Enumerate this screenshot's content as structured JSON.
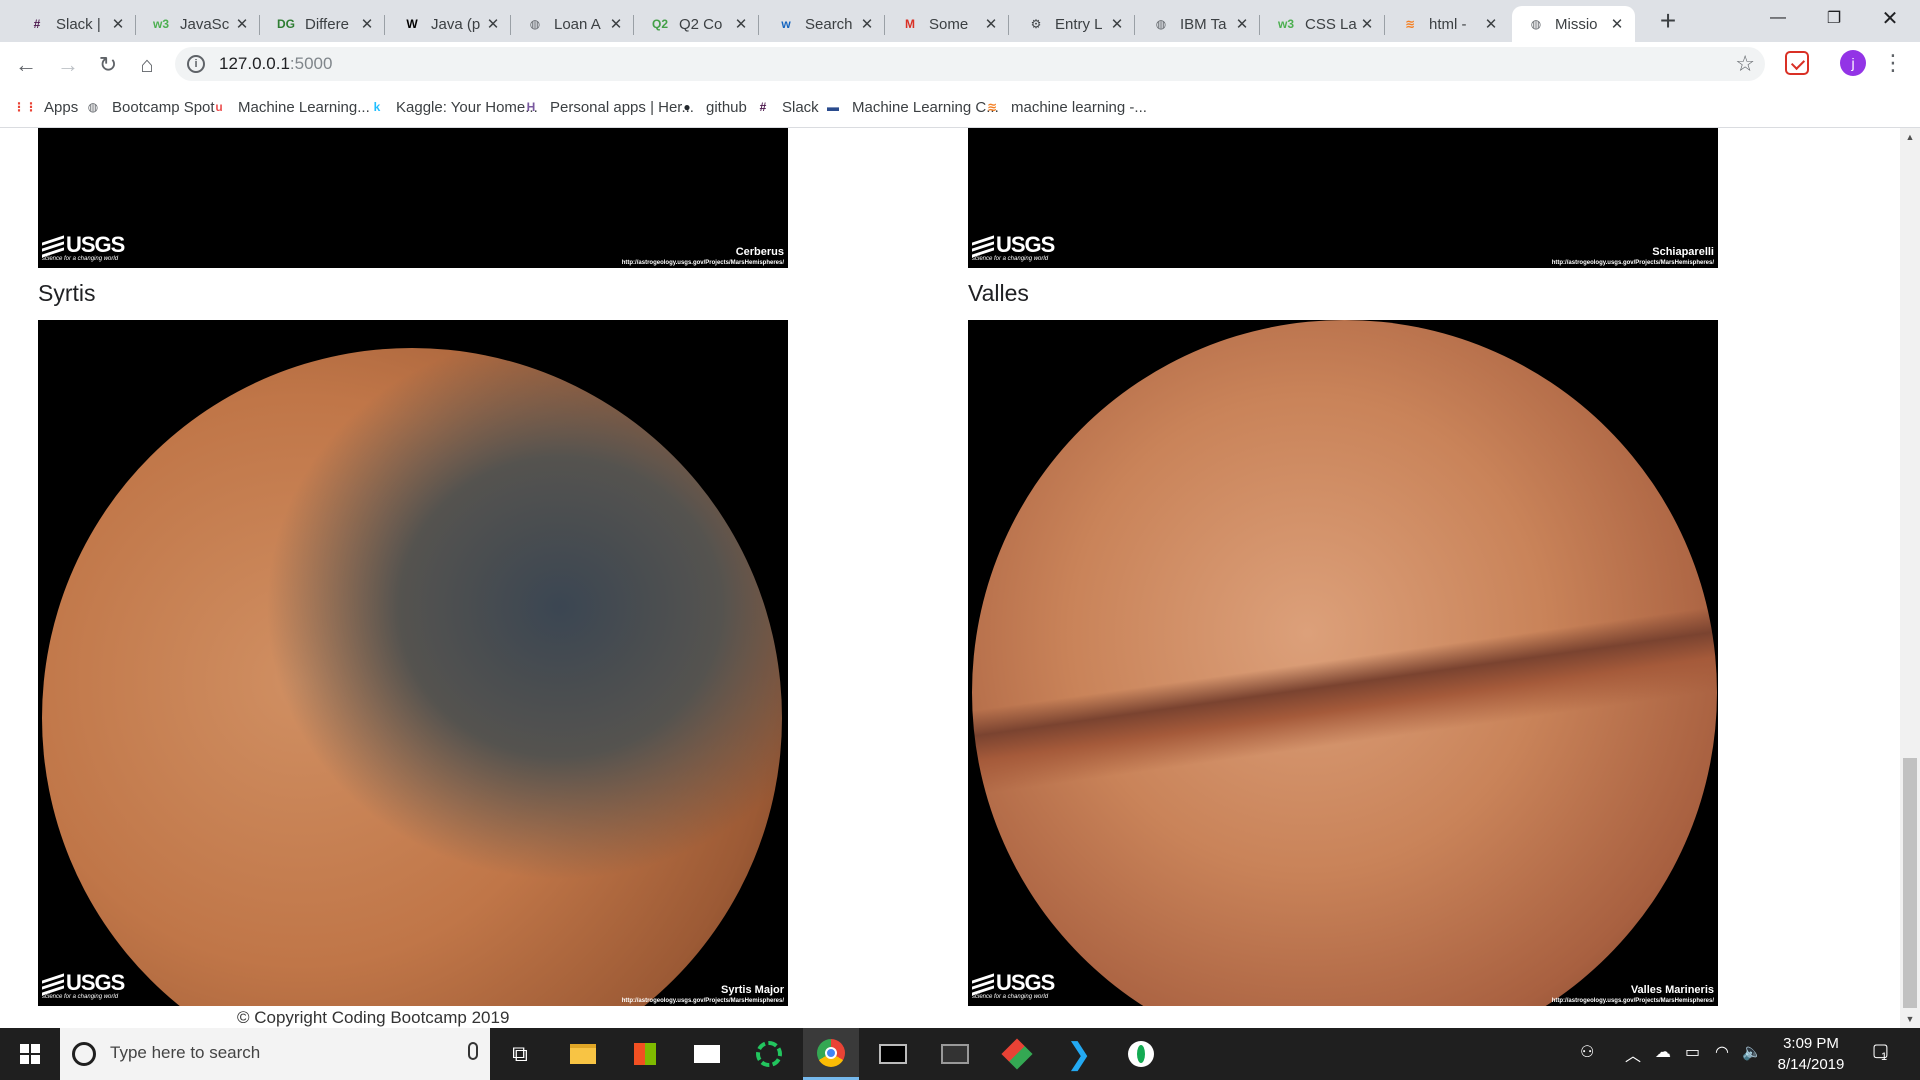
{
  "browser": {
    "tabs": [
      {
        "label": "Slack |",
        "icon": "slack-icon",
        "icon_color": "#4a154b",
        "glyph": "#"
      },
      {
        "label": "JavaSc",
        "icon": "w3schools-icon",
        "icon_color": "#4caf50",
        "glyph": "w3"
      },
      {
        "label": "Differe",
        "icon": "devguru-icon",
        "icon_color": "#2e7d32",
        "glyph": "DG"
      },
      {
        "label": "Java (p",
        "icon": "wikipedia-icon",
        "icon_color": "#000000",
        "glyph": "W"
      },
      {
        "label": "Loan A",
        "icon": "globe-icon",
        "icon_color": "#5f6368",
        "glyph": "◍"
      },
      {
        "label": "Q2 Co",
        "icon": "q2-icon",
        "icon_color": "#43a047",
        "glyph": "Q2"
      },
      {
        "label": "Search",
        "icon": "search-site-icon",
        "icon_color": "#1565c0",
        "glyph": "w"
      },
      {
        "label": "Some",
        "icon": "gmail-icon",
        "icon_color": "#d93025",
        "glyph": "M"
      },
      {
        "label": "Entry L",
        "icon": "entry-icon",
        "icon_color": "#3c4043",
        "glyph": "⚙"
      },
      {
        "label": "IBM Ta",
        "icon": "globe-icon",
        "icon_color": "#5f6368",
        "glyph": "◍"
      },
      {
        "label": "CSS La",
        "icon": "w3schools-icon",
        "icon_color": "#4caf50",
        "glyph": "w3"
      },
      {
        "label": "html -",
        "icon": "stackoverflow-icon",
        "icon_color": "#f48024",
        "glyph": "≋"
      },
      {
        "label": "Missio",
        "icon": "globe-icon",
        "icon_color": "#5f6368",
        "glyph": "◍",
        "active": true
      }
    ],
    "new_tab_label": "+",
    "url_host": "127.0.0.1",
    "url_port": ":5000",
    "info_glyph": "i",
    "profile_initial": "j",
    "bookmarks": [
      {
        "label": "Apps",
        "icon": "apps-grid-icon",
        "color": "#ea4335",
        "glyph": "⋮⋮"
      },
      {
        "label": "Bootcamp Spot",
        "icon": "globe-icon",
        "color": "#5f6368",
        "glyph": "◍"
      },
      {
        "label": "Machine Learning...",
        "icon": "udemy-icon",
        "color": "#ec5252",
        "glyph": "u"
      },
      {
        "label": "Kaggle: Your Home...",
        "icon": "kaggle-icon",
        "color": "#20beff",
        "glyph": "k"
      },
      {
        "label": "Personal apps | Her...",
        "icon": "heroku-icon",
        "color": "#79589f",
        "glyph": "H"
      },
      {
        "label": "github",
        "icon": "github-icon",
        "color": "#24292e",
        "glyph": "●"
      },
      {
        "label": "Slack",
        "icon": "slack-icon",
        "color": "#4a154b",
        "glyph": "#"
      },
      {
        "label": "Machine Learning C...",
        "icon": "coursera-icon",
        "color": "#2a4b8d",
        "glyph": "▬"
      },
      {
        "label": "machine learning -...",
        "icon": "stackoverflow-icon",
        "color": "#f48024",
        "glyph": "≋"
      }
    ]
  },
  "page": {
    "hemispheres": [
      {
        "title": "",
        "name_on_image": "Cerberus",
        "variant": "cerberus"
      },
      {
        "title": "",
        "name_on_image": "Schiaparelli",
        "variant": "schiaparelli"
      },
      {
        "title": "Syrtis",
        "name_on_image": "Syrtis Major",
        "variant": "syrtis"
      },
      {
        "title": "Valles",
        "name_on_image": "Valles Marineris",
        "variant": "valles"
      }
    ],
    "image_url_text": "http://astrogeology.usgs.gov/Projects/MarsHemispheres/",
    "usgs_word": "USGS",
    "usgs_tagline": "science for a changing world",
    "copyright": "© Copyright Coding Bootcamp 2019"
  },
  "taskbar": {
    "search_placeholder": "Type here to search",
    "time": "3:09 PM",
    "date": "8/14/2019",
    "notification_count": "1"
  }
}
